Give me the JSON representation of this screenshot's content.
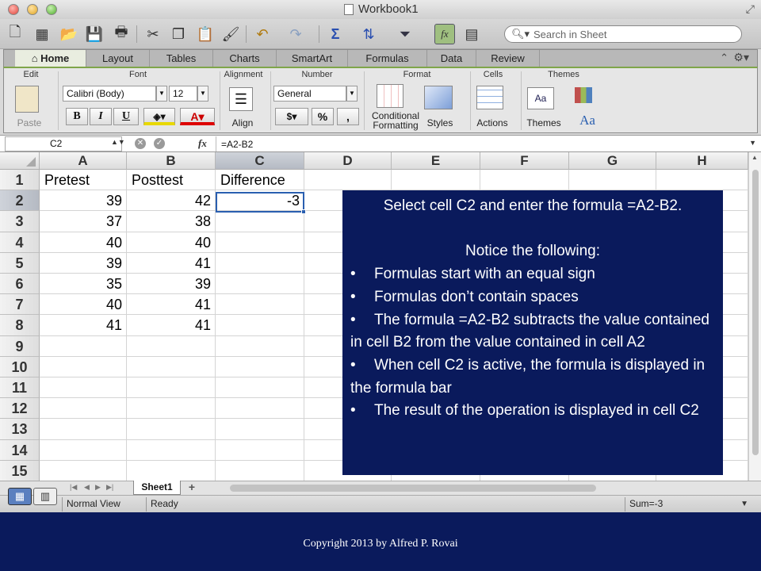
{
  "window": {
    "title": "Workbook1"
  },
  "toolbar": {
    "icons": [
      "new-workbook-icon",
      "templates-icon",
      "open-icon",
      "save-icon",
      "print-icon",
      "cut-icon",
      "copy-icon",
      "paste-icon",
      "format-painter-icon",
      "undo-icon",
      "redo-icon",
      "autosum-icon",
      "sort-icon",
      "filter-icon",
      "formula-builder-icon",
      "toolbox-icon"
    ],
    "search_placeholder": "Search in Sheet"
  },
  "ribbon": {
    "tabs": [
      {
        "label": "Home",
        "active": true
      },
      {
        "label": "Layout",
        "active": false
      },
      {
        "label": "Tables",
        "active": false
      },
      {
        "label": "Charts",
        "active": false
      },
      {
        "label": "SmartArt",
        "active": false
      },
      {
        "label": "Formulas",
        "active": false
      },
      {
        "label": "Data",
        "active": false
      },
      {
        "label": "Review",
        "active": false
      }
    ],
    "groups": {
      "edit": {
        "title": "Edit",
        "paste_label": "Paste"
      },
      "font": {
        "title": "Font",
        "font_name": "Calibri (Body)",
        "font_size": "12",
        "bold": "B",
        "italic": "I",
        "underline": "U"
      },
      "alignment": {
        "title": "Alignment",
        "align_label": "Align"
      },
      "number": {
        "title": "Number",
        "format": "General",
        "percent": "%",
        "comma": ","
      },
      "format": {
        "title": "Format",
        "conditional_line1": "Conditional",
        "conditional_line2": "Formatting",
        "styles_label": "Styles"
      },
      "cells": {
        "title": "Cells",
        "actions_label": "Actions"
      },
      "themes": {
        "title": "Themes",
        "themes_label": "Themes",
        "font_sample": "Aa"
      }
    }
  },
  "formula_bar": {
    "name_box": "C2",
    "fx": "fx",
    "formula": "=A2-B2"
  },
  "grid": {
    "columns": [
      "A",
      "B",
      "C",
      "D",
      "E",
      "F",
      "G",
      "H"
    ],
    "selected_column": "C",
    "rows": [
      "1",
      "2",
      "3",
      "4",
      "5",
      "6",
      "7",
      "8",
      "9",
      "10",
      "11",
      "12",
      "13",
      "14",
      "15"
    ],
    "selected_row": "2",
    "cells": [
      [
        "Pretest",
        "Posttest",
        "Difference"
      ],
      [
        "39",
        "42",
        "-3"
      ],
      [
        "37",
        "38",
        ""
      ],
      [
        "40",
        "40",
        ""
      ],
      [
        "39",
        "41",
        ""
      ],
      [
        "35",
        "39",
        ""
      ],
      [
        "40",
        "41",
        ""
      ],
      [
        "41",
        "41",
        ""
      ]
    ]
  },
  "sheets": {
    "tabs": [
      "Sheet1"
    ],
    "add": "+"
  },
  "status": {
    "view": "Normal View",
    "mode": "Ready",
    "sum": "Sum=-3"
  },
  "callout": {
    "heading": "Select cell C2 and enter the formula =A2-B2.",
    "subheading": "Notice the following:",
    "bullets": [
      "Formulas start with an equal sign",
      "Formulas don’t contain spaces",
      "The formula =A2-B2 subtracts the value contained in cell B2 from the value contained in cell A2",
      "When cell C2 is active, the formula is displayed in the formula bar",
      "The result of the operation is displayed in cell C2"
    ],
    "bullet_glyph": "•"
  },
  "footer": {
    "copyright": "Copyright 2013 by Alfred P. Rovai"
  },
  "colors": {
    "slide_background": "#0a1a5c",
    "ribbon_accent": "#7fa54a",
    "selection": "#2a5fb0"
  }
}
